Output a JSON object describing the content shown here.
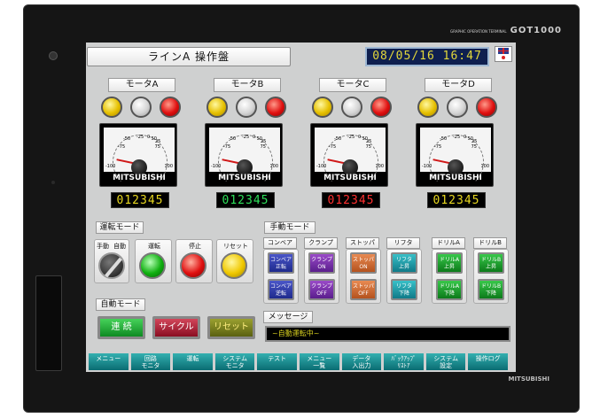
{
  "device": {
    "brand_top": "GOT1000",
    "brand_top_small": "GRAPHIC OPERATION TERMINAL",
    "brand_bottom": "MITSUBISHI"
  },
  "header": {
    "title": "ラインA 操作盤",
    "datetime": "08/05/16 16:47"
  },
  "motors": [
    {
      "label": "モータA",
      "counter": "012345",
      "counter_color": "#e8d820"
    },
    {
      "label": "モータB",
      "counter": "012345",
      "counter_color": "#2ee05a"
    },
    {
      "label": "モータC",
      "counter": "012345",
      "counter_color": "#ff3030"
    },
    {
      "label": "モータD",
      "counter": "012345",
      "counter_color": "#e8d820"
    }
  ],
  "meter": {
    "brand": "MITSUBISHI",
    "scale": [
      "-100",
      "-75",
      "-50",
      "-25",
      "0",
      "25",
      "50",
      "75",
      "100"
    ]
  },
  "run_mode": {
    "label": "運転モード",
    "selector_left": "手動",
    "selector_right": "自動",
    "buttons": [
      "運転",
      "停止",
      "リセット"
    ]
  },
  "manual_mode": {
    "label": "手動モード",
    "groups": [
      {
        "label": "コンベア",
        "buttons": [
          "コンベア\n正転",
          "コンベア\n逆転"
        ]
      },
      {
        "label": "クランプ",
        "buttons": [
          "クランプ\nON",
          "クランプ\nOFF"
        ]
      },
      {
        "label": "ストッパ",
        "buttons": [
          "ストッパ\nON",
          "ストッパ\nOFF"
        ]
      },
      {
        "label": "リフタ",
        "buttons": [
          "リフタ\n上昇",
          "リフタ\n下降"
        ]
      },
      {
        "label": "ドリルA",
        "buttons": [
          "ドリルA\n上昇",
          "ドリルA\n下降"
        ]
      },
      {
        "label": "ドリルB",
        "buttons": [
          "ドリルB\n上昇",
          "ドリルB\n下降"
        ]
      }
    ]
  },
  "auto_mode": {
    "label": "自動モード",
    "buttons": [
      "連 続",
      "サイクル",
      "リセット"
    ]
  },
  "message": {
    "label": "メッセージ",
    "text": "~自動運転中~"
  },
  "function_keys": [
    "メニュー",
    "回路\nモニタ",
    "運転",
    "システム\nモニタ",
    "テスト",
    "メニュー\n一覧",
    "データ\n入出力",
    "ﾊﾞｯｸｱｯﾌﾟ\nﾘｽﾄｱ",
    "システム\n設定",
    "操作ログ"
  ],
  "colors": {
    "screen_bg": "#cfd0d0",
    "clock_text": "#e3d83a",
    "function_key": "#1a8a90"
  }
}
